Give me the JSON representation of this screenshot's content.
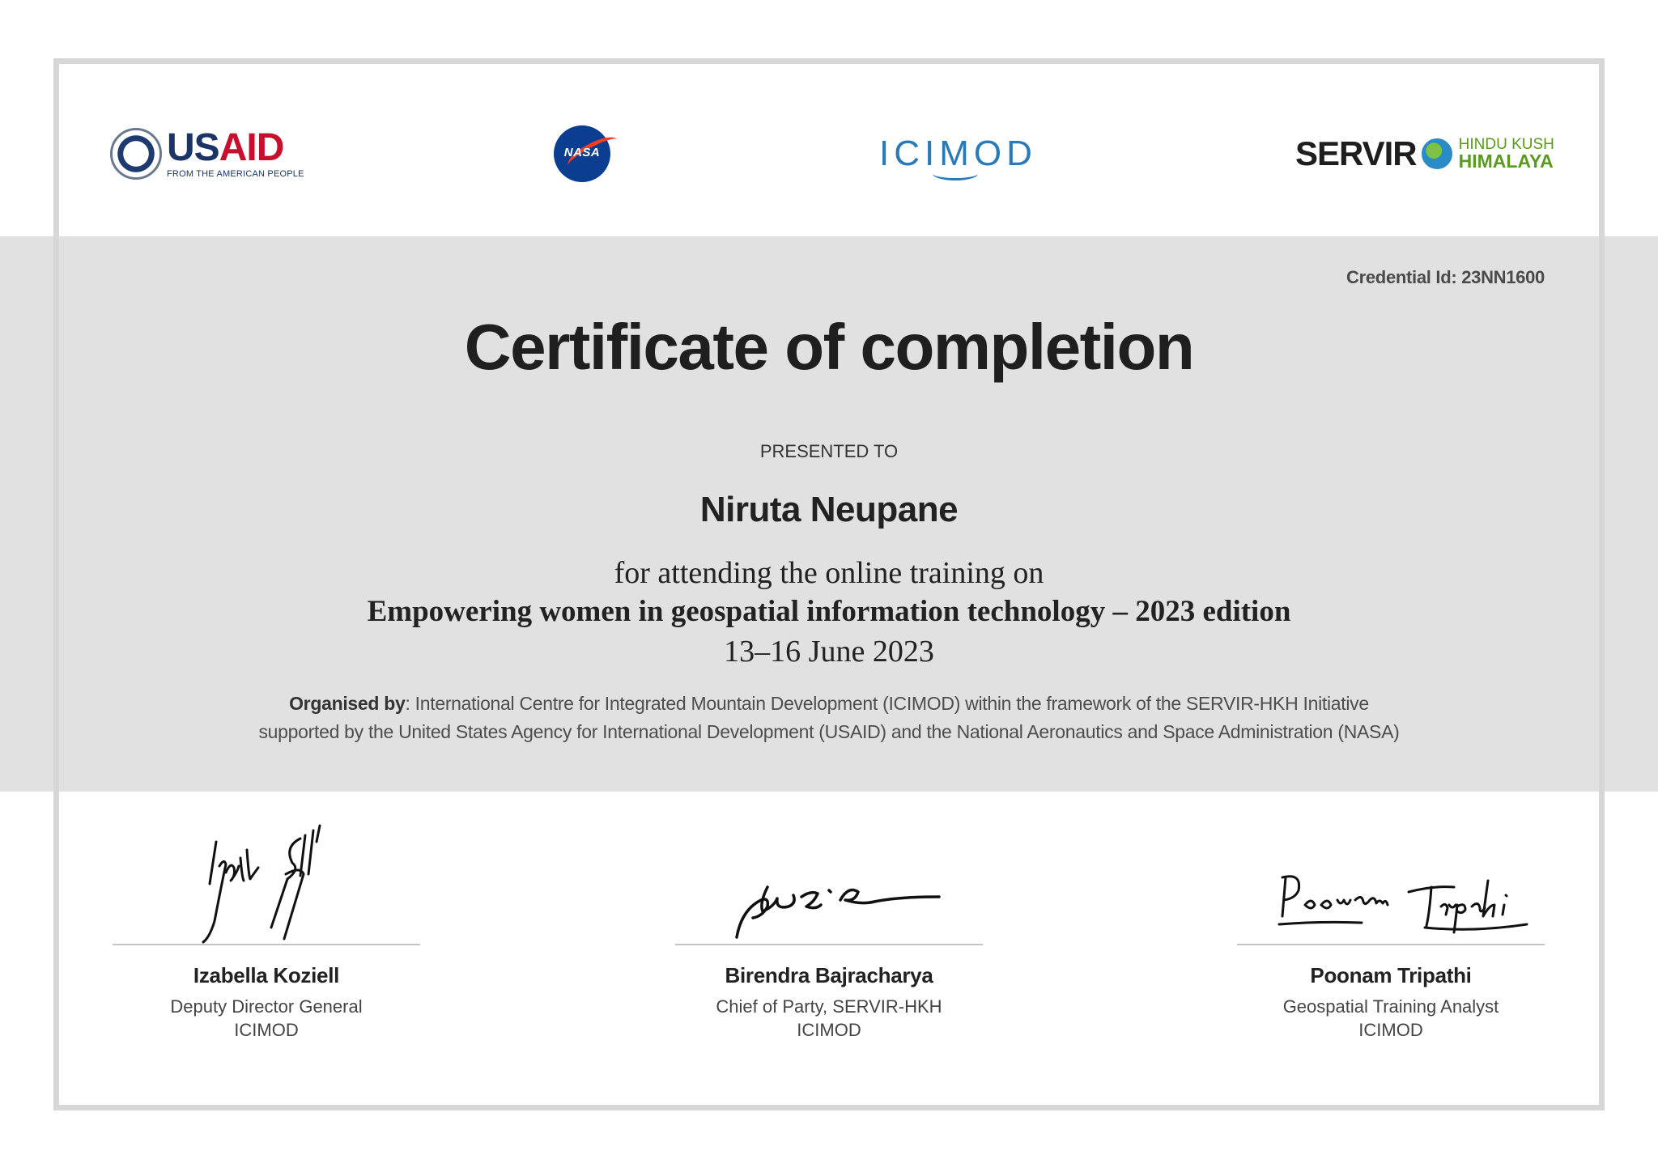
{
  "logos": {
    "usaid": {
      "main_us": "US",
      "main_aid": "AID",
      "tagline": "FROM THE AMERICAN PEOPLE",
      "seal": "USAID"
    },
    "nasa": {
      "label": "NASA"
    },
    "icimod": {
      "label": "ICIMOD"
    },
    "servir": {
      "main": "SERVIR",
      "sub_line1": "HINDU KUSH",
      "sub_line2": "HIMALAYA"
    }
  },
  "credential": "Credential Id: 23NN1600",
  "title": "Certificate of completion",
  "presented_to": "PRESENTED TO",
  "recipient": "Niruta Neupane",
  "line1": "for attending the online training on",
  "course": "Empowering women in geospatial information technology – 2023 edition",
  "dates": "13–16 June 2023",
  "organised": {
    "label": "Organised by",
    "text_line1": ":  International Centre for Integrated Mountain Development (ICIMOD) within the framework of the SERVIR-HKH Initiative",
    "text_line2": "supported by the United States Agency for International Development (USAID) and the National Aeronautics and Space Administration (NASA)"
  },
  "signers": [
    {
      "name": "Izabella Koziell",
      "role": "Deputy Director General",
      "org": "ICIMOD",
      "signature": "Izabella Koziell"
    },
    {
      "name": "Birendra Bajracharya",
      "role": "Chief of Party, SERVIR-HKH",
      "org": "ICIMOD",
      "signature": "Birendra Bajracharya"
    },
    {
      "name": "Poonam Tripathi",
      "role": "Geospatial Training Analyst",
      "org": "ICIMOD",
      "signature": "Poonam Tripathi"
    }
  ],
  "colors": {
    "band": "#e1e1e1",
    "frame": "#d7d7d7",
    "usaid_blue": "#1a3466",
    "usaid_red": "#c8102e",
    "nasa_blue": "#0b3d91",
    "nasa_red": "#fc3d21",
    "icimod_blue": "#2a7ab8",
    "servir_green": "#5a9a1e"
  }
}
